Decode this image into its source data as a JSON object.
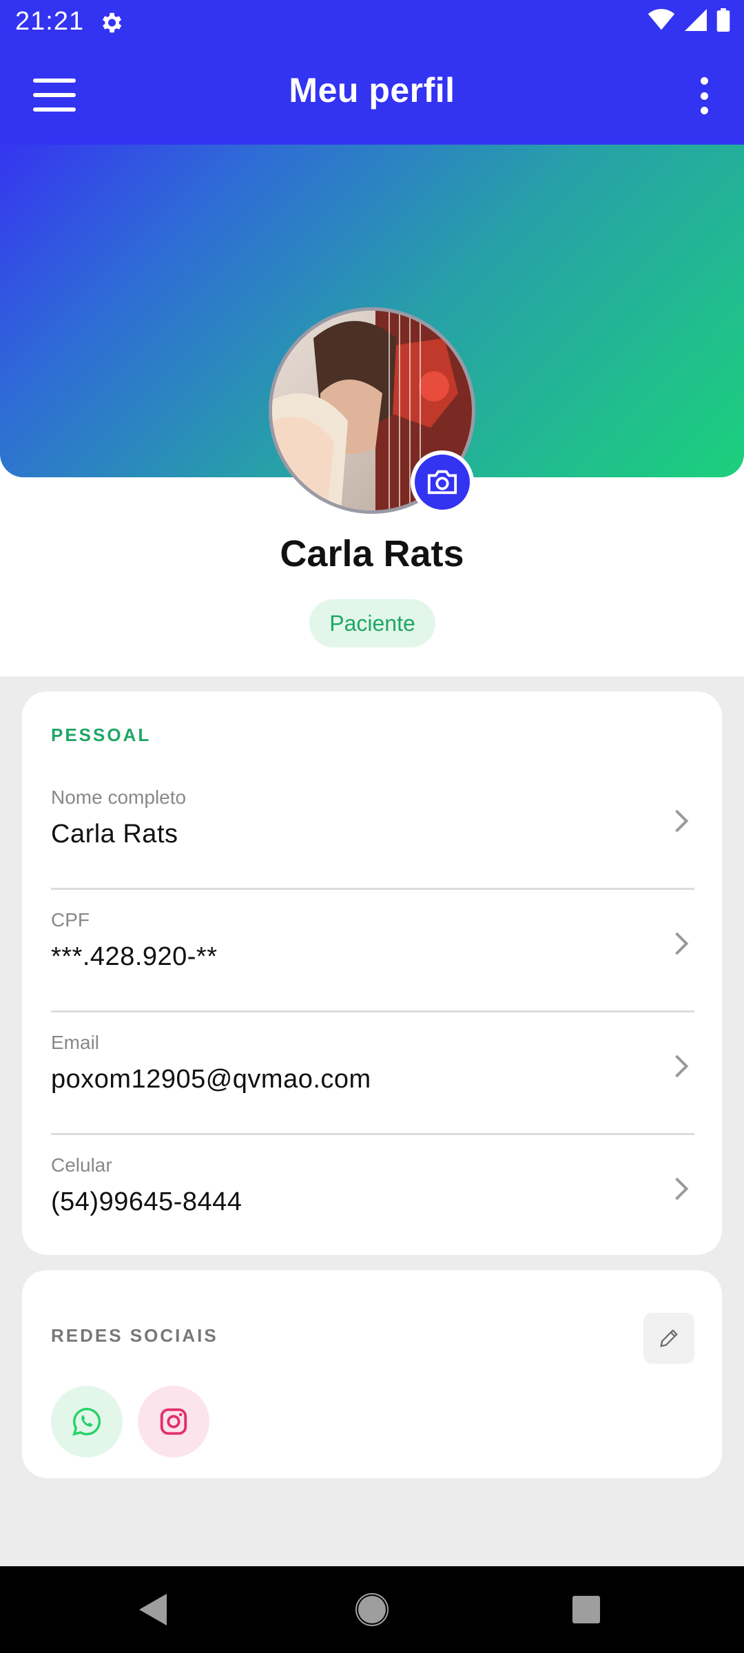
{
  "status_bar": {
    "time": "21:21"
  },
  "app_bar": {
    "title": "Meu perfil"
  },
  "profile": {
    "name": "Carla Rats",
    "role": "Paciente"
  },
  "personal": {
    "section_title": "PESSOAL",
    "fields": [
      {
        "label": "Nome completo",
        "value": "Carla Rats"
      },
      {
        "label": "CPF",
        "value": "***.428.920-**"
      },
      {
        "label": "Email",
        "value": "poxom12905@qvmao.com"
      },
      {
        "label": "Celular",
        "value": "(54)99645-8444"
      }
    ]
  },
  "social": {
    "section_title": "REDES SOCIAIS",
    "networks": [
      {
        "icon": "whatsapp-icon",
        "color": "#25d366"
      },
      {
        "icon": "instagram-icon",
        "color": "#e1306c"
      }
    ]
  },
  "colors": {
    "primary": "#3333f2",
    "accent_green": "#1ea765",
    "background": "#ececec"
  }
}
